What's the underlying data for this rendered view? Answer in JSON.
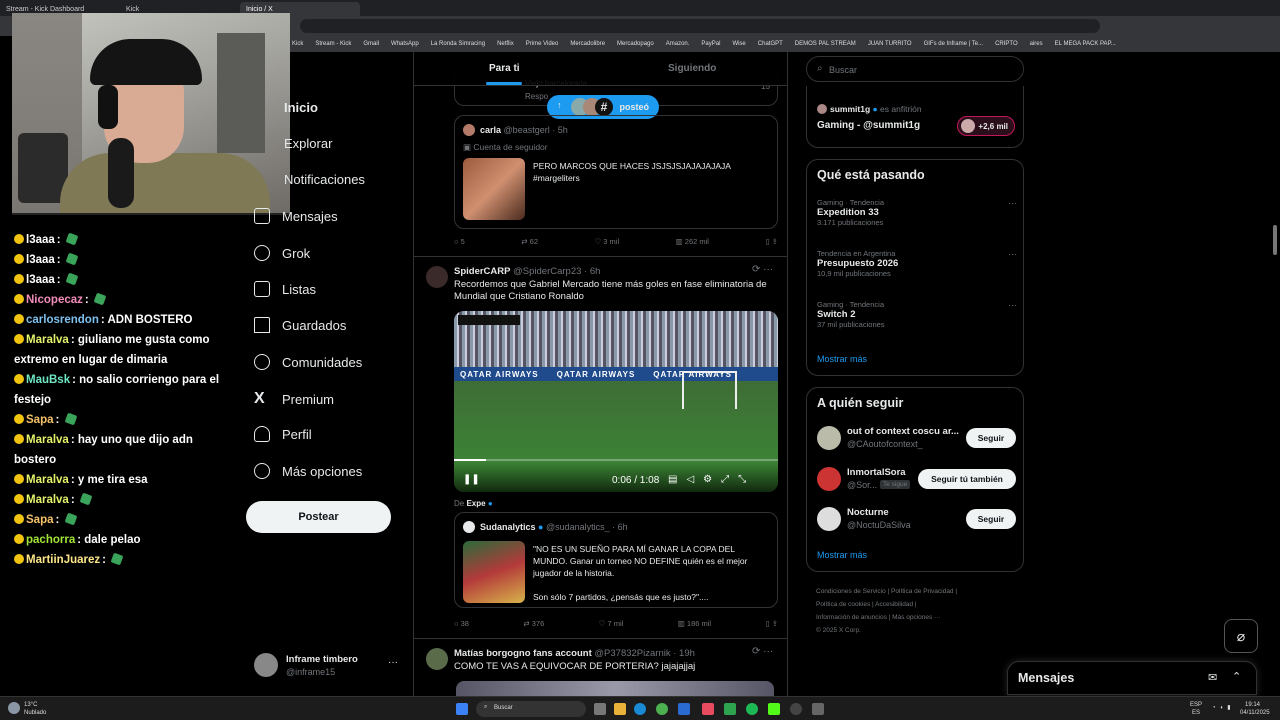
{
  "browser": {
    "tabs": [
      "Stream - Kick Dashboard",
      "Kick",
      "Inicio / X"
    ],
    "bookmarks": [
      "Kick",
      "Stream - Kick",
      "Gmail",
      "WhatsApp",
      "La Ronda Simracing",
      "Netflix",
      "Prime Video",
      "Mercadolibre",
      "Mercadopago",
      "Amazon.",
      "PayPal",
      "Wise",
      "ChatGPT",
      "DEMOS PAL STREAM",
      "JUAN TURRITO",
      "GIFs de Inframe | Te...",
      "CRIPTO",
      "aires",
      "EL MEGA PACK PAP..."
    ]
  },
  "chat": [
    {
      "user": "l3aaa",
      "color": "#ffffff",
      "msg": ""
    },
    {
      "user": "l3aaa",
      "color": "#ffffff",
      "msg": ""
    },
    {
      "user": "l3aaa",
      "color": "#ffffff",
      "msg": ""
    },
    {
      "user": "Nicopecaz",
      "color": "#f28cba",
      "msg": ""
    },
    {
      "user": "carlosrendon",
      "color": "#7ec0ee",
      "msg": "ADN BOSTERO"
    },
    {
      "user": "Maralva",
      "color": "#e4f36a",
      "msg": "giuliano me gusta como"
    },
    {
      "user": "",
      "color": "#ffffff",
      "msg": "extremo en lugar de dimaria"
    },
    {
      "user": "MauBsk",
      "color": "#6ee7c5",
      "msg": "no salio corriengo para el"
    },
    {
      "user": "",
      "color": "#ffffff",
      "msg": "festejo"
    },
    {
      "user": "Sapa",
      "color": "#f5c26b",
      "msg": ""
    },
    {
      "user": "Maralva",
      "color": "#e4f36a",
      "msg": "hay uno que dijo adn"
    },
    {
      "user": "",
      "color": "#ffffff",
      "msg": "bostero"
    },
    {
      "user": "Maralva",
      "color": "#e4f36a",
      "msg": "y me tira esa"
    },
    {
      "user": "Maralva",
      "color": "#e4f36a",
      "msg": ""
    },
    {
      "user": "Sapa",
      "color": "#f5c26b",
      "msg": ""
    },
    {
      "user": "pachorra",
      "color": "#a3e635",
      "msg": "dale pelao"
    },
    {
      "user": "MartiinJuarez",
      "color": "#fde68a",
      "msg": ""
    }
  ],
  "nav": {
    "items": [
      "Inicio",
      "Explorar",
      "Notificaciones",
      "Mensajes",
      "Grok",
      "Listas",
      "Guardados",
      "Comunidades",
      "Premium",
      "Perfil",
      "Más opciones"
    ],
    "post_label": "Postear",
    "account_name": "Inframe timbero",
    "account_handle": "@inframe15"
  },
  "feed": {
    "tab_foryou": "Para ti",
    "tab_following": "Siguiendo",
    "new_posts": "posteó",
    "top_snippet": "Viejo barcelorada",
    "top_snippet_meta": "Respo",
    "top_count": "15",
    "quote1": {
      "name": "carla",
      "handle": "@beastgerl · 5h",
      "note": "Cuenta de seguidor",
      "text": "PERO MARCOS QUE HACES JSJSJSJAJAJAJAJA #margeliters"
    },
    "actions1": {
      "replies": "5",
      "reposts": "62",
      "likes": "3 mil",
      "views": "262 mil"
    },
    "tweet2": {
      "name": "SpiderCARP",
      "handle": "@SpiderCarp23 · 6h",
      "text": "Recordemos que Gabriel Mercado tiene más goles en fase eliminatoria de Mundial que Cristiano Ronaldo",
      "video_time": "0:06 / 1:08",
      "ad_text": "QATAR AIRWAYS",
      "from_label": "De",
      "from_name": "Expe"
    },
    "quote2": {
      "name": "Sudanalytics",
      "handle": "@sudanalytics_ · 6h",
      "text": "\"NO ES UN SUEÑO PARA MÍ GANAR LA COPA DEL MUNDO. Ganar un torneo NO DEFINE quién es el mejor jugador de la historia.",
      "text2": "Son sólo 7 partidos, ¿pensás que es justo?\"...."
    },
    "actions2": {
      "replies": "38",
      "reposts": "376",
      "likes": "7 mil",
      "views": "186 mil"
    },
    "tweet3": {
      "name": "Matías borgogno fans account",
      "handle": "@P37832Pizarnik · 19h",
      "text": "COMO TE VAS A EQUIVOCAR DE PORTERIA? jajajajjaj"
    }
  },
  "right": {
    "search_placeholder": "Buscar",
    "live": {
      "host": "summit1g",
      "host_note": "es anfitrión",
      "title": "Gaming - @summit1g",
      "viewers": "+2,6 mil"
    },
    "trends_title": "Qué está pasando",
    "trends": [
      {
        "meta": "Gaming · Tendencia",
        "name": "Expedition 33",
        "count": "3.171 publicaciones"
      },
      {
        "meta": "Tendencia en Argentina",
        "name": "Presupuesto 2026",
        "count": "10,9 mil publicaciones"
      },
      {
        "meta": "Gaming · Tendencia",
        "name": "Switch 2",
        "count": "37 mil publicaciones"
      }
    ],
    "show_more": "Mostrar más",
    "follow_title": "A quién seguir",
    "follows": [
      {
        "name": "out of context coscu ar...",
        "handle": "@CAoutofcontext_",
        "btn": "Seguir",
        "badge": ""
      },
      {
        "name": "InmortalSora",
        "handle": "@Sor...",
        "btn": "Seguir tú también",
        "badge": "Te sigue"
      },
      {
        "name": "Nocturne",
        "handle": "@NoctuDaSilva",
        "btn": "Seguir",
        "badge": ""
      }
    ],
    "footer": [
      "Condiciones de Servicio",
      "Política de Privacidad",
      "Política de cookies",
      "Accesibilidad",
      "Información de anuncios",
      "Más opciones ···",
      "© 2025 X Corp."
    ],
    "messages": "Mensajes"
  },
  "taskbar": {
    "weather_temp": "13°C",
    "weather_desc": "Nublado",
    "search": "Buscar",
    "lang": "ESP",
    "lang2": "ES",
    "time": "19:14",
    "date": "04/11/2025"
  }
}
